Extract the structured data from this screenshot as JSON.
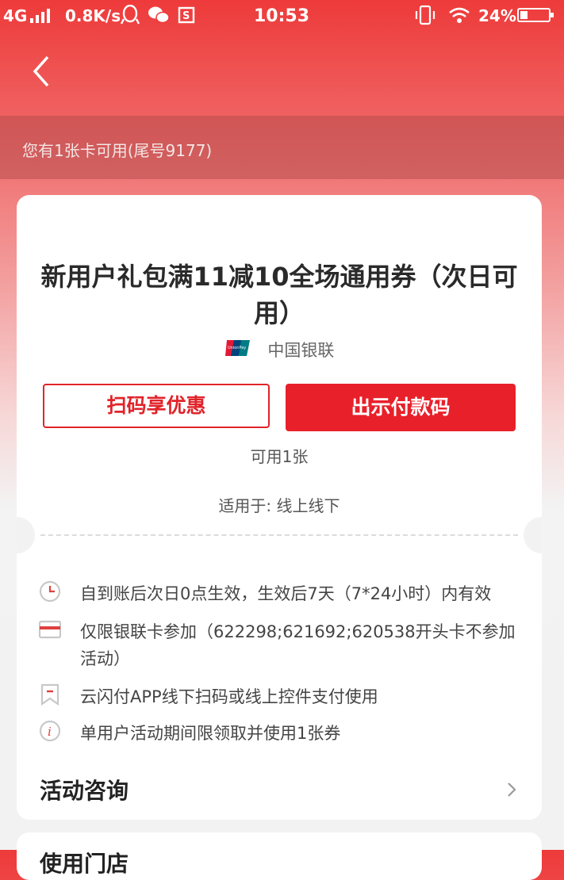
{
  "status_bar": {
    "network": "4G",
    "speed": "0.8K/s",
    "time": "10:53",
    "battery": "24%"
  },
  "nav": {
    "back_icon": "chevron-left-icon"
  },
  "card_strip": {
    "text": "您有1张卡可用(尾号9177)"
  },
  "coupon": {
    "title": "新用户礼包满11减10全场通用券（次日可用）",
    "issuer": "中国银联",
    "issuer_logo": "unionpay-logo",
    "scan_button": "扫码享优惠",
    "pay_button": "出示付款码",
    "available": "可用1张",
    "applicable": "适用于: 线上线下",
    "rules": [
      {
        "icon": "clock-icon",
        "text": "自到账后次日0点生效，生效后7天（7*24小时）内有效"
      },
      {
        "icon": "card-icon",
        "text": "仅限银联卡参加（622298;621692;620538开头卡不参加活动）"
      },
      {
        "icon": "bookmark-icon",
        "text": "云闪付APP线下扫码或线上控件支付使用"
      },
      {
        "icon": "info-icon",
        "text": "单用户活动期间限领取并使用1张券"
      }
    ],
    "consult_label": "活动咨询"
  },
  "next_section": {
    "label": "使用门店"
  },
  "colors": {
    "brand_red": "#e8202a",
    "header_red": "#ee3a3a"
  }
}
